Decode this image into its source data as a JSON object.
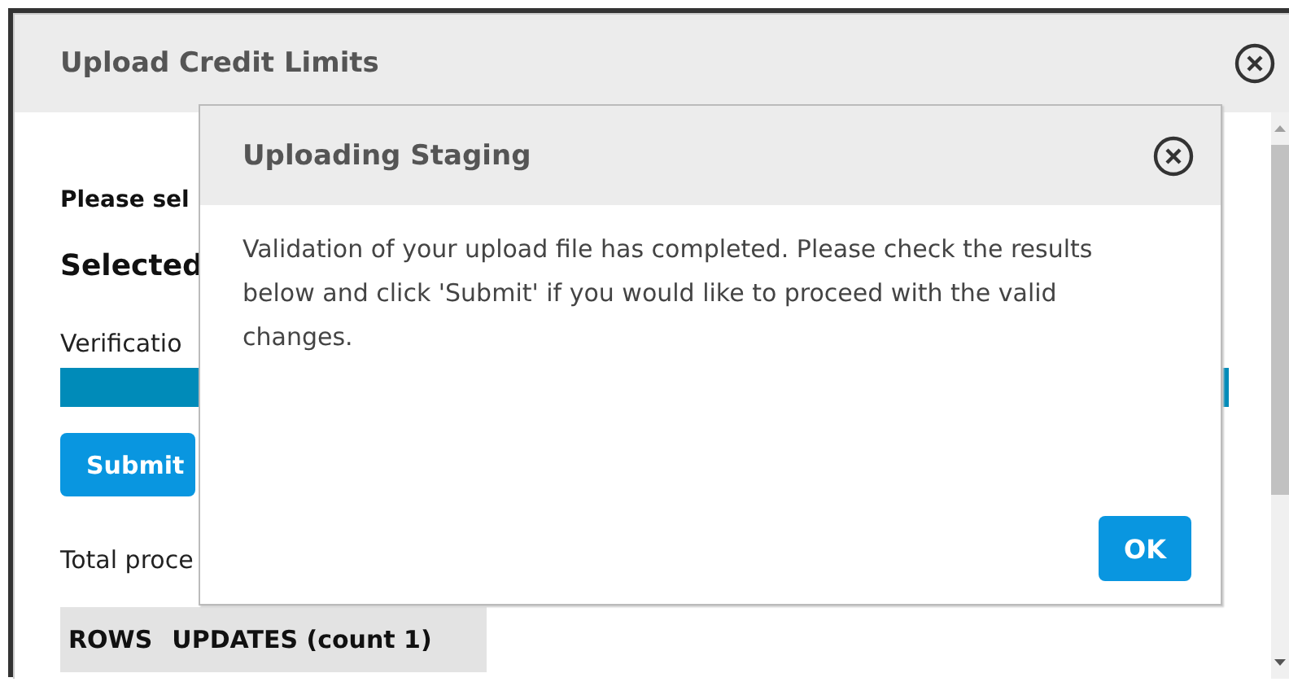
{
  "dialog": {
    "title": "Upload Credit Limits",
    "body": {
      "prompt": "Please sel",
      "selected_heading": "Selected",
      "verification_label": "Verificatio",
      "progress": {
        "level": 1
      },
      "submit_button": "Submit",
      "total_label": "Total proce",
      "table": {
        "columns": [
          "ROWS",
          "UPDATES (count 1)"
        ]
      }
    }
  },
  "modal": {
    "title": "Uploading Staging",
    "message": "Validation of your upload file has completed. Please check the results below and click 'Submit' if you would like to proceed with the valid changes.",
    "ok_button": "OK"
  }
}
